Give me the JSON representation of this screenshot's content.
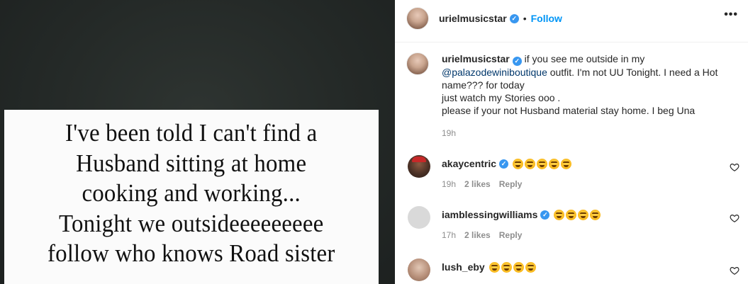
{
  "media": {
    "text_lines": "I've been told I can't find a\nHusband sitting at home\ncooking and working...\nTonight we outsideeeeeeeee\nfollow who knows Road sister"
  },
  "header": {
    "username": "urielmusicstar",
    "dot": "•",
    "follow_label": "Follow",
    "more_label": "•••"
  },
  "caption": {
    "username": "urielmusicstar",
    "text_before_mention": "if you see me outside in my",
    "mention": "@palazodewiniboutique",
    "text_after_mention": "outfit. I'm not UU Tonight. I need a Hot name??? for today",
    "line2": "just watch my Stories ooo .",
    "line3": "please if your not Husband material stay home. I beg Una",
    "time": "19h"
  },
  "comments": [
    {
      "username": "akaycentric",
      "time": "19h",
      "likes": "2 likes",
      "reply": "Reply",
      "emoji_count": 5
    },
    {
      "username": "iamblessingwilliams",
      "time": "17h",
      "likes": "2 likes",
      "reply": "Reply",
      "emoji_count": 4
    },
    {
      "username": "lush_eby",
      "time": "",
      "likes": "",
      "reply": "",
      "emoji_count": 4
    }
  ],
  "colors": {
    "accent": "#0095f6",
    "verified": "#3897f0",
    "mention": "#00376b",
    "meta": "#8e8e8e"
  },
  "icons": {
    "verified": "verified-badge-icon",
    "like": "heart-icon",
    "more": "more-options-icon",
    "emoji": "anxious-face-emoji-icon"
  }
}
